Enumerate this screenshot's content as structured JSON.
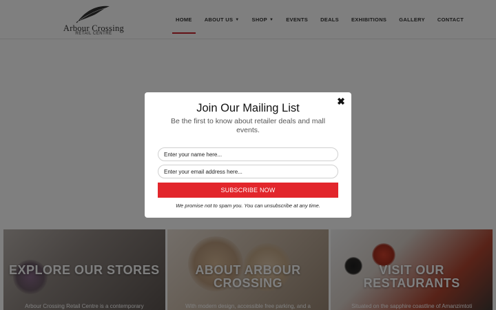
{
  "logo": {
    "title": "Arbour Crossing",
    "subtitle": "RETAIL CENTRE"
  },
  "nav": {
    "items": [
      {
        "label": "HOME",
        "active": true
      },
      {
        "label": "ABOUT US",
        "has_dropdown": true
      },
      {
        "label": "SHOP",
        "has_dropdown": true
      },
      {
        "label": "EVENTS"
      },
      {
        "label": "DEALS"
      },
      {
        "label": "EXHIBITIONS"
      },
      {
        "label": "GALLERY"
      },
      {
        "label": "CONTACT"
      }
    ],
    "active_color": "#c8202a",
    "dropdown_icon": "chevron-down-icon"
  },
  "tiles": [
    {
      "title": "EXPLORE OUR STORES",
      "text": "Arbour Crossing Retail Centre is a contemporary"
    },
    {
      "title": "ABOUT ARBOUR CROSSING",
      "text": "With modern design, accessible free parking, and a"
    },
    {
      "title": "VISIT OUR RESTAURANTS",
      "text": "Situated on the sapphire coastline of Amanzimtoti"
    }
  ],
  "modal": {
    "title": "Join Our Mailing List",
    "subtitle": "Be the first to know about retailer deals and mall events.",
    "name_placeholder": "Enter your name here...",
    "email_placeholder": "Enter your email address here...",
    "subscribe_label": "SUBSCRIBE NOW",
    "disclaimer": "We promise not to spam you. You can unsubscribe at any time.",
    "close_icon": "close-icon",
    "button_color": "#e2262c"
  }
}
